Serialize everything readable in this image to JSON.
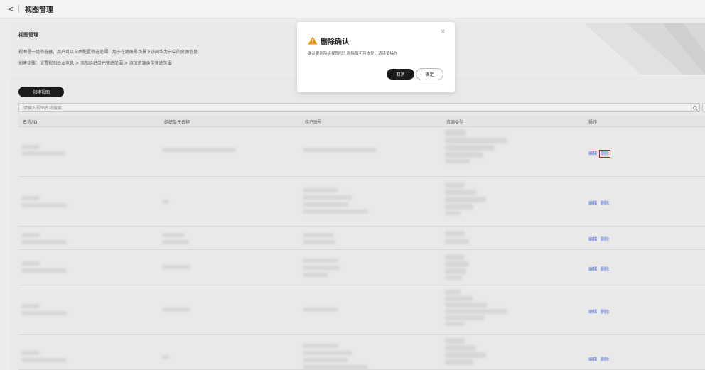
{
  "header": {
    "back_glyph": "<",
    "title": "视图管理"
  },
  "banner": {
    "title": "视图管理",
    "description": "视图是一组筛选器，用户可以自由配置筛选范围，用于在跨账号场景下访问华为云中的资源信息",
    "steps": "创建步骤：设置视图基本信息 > 添加组织单元筛选范围 > 添加资源类型筛选范围"
  },
  "toolbar": {
    "create_label": "创建视图"
  },
  "search": {
    "placeholder": "请输入视图名称搜索"
  },
  "table": {
    "columns": [
      "名称/ID",
      "组织单元名称",
      "租户账号",
      "资源类型",
      "操作"
    ],
    "rows": [
      {
        "edit": "编辑",
        "delete": "删除"
      },
      {
        "edit": "编辑",
        "delete": "删除"
      },
      {
        "edit": "编辑",
        "delete": "删除"
      },
      {
        "edit": "编辑",
        "delete": "删除"
      },
      {
        "edit": "编辑",
        "delete": "删除"
      },
      {
        "edit": "编辑",
        "delete": "删除"
      }
    ]
  },
  "dialog": {
    "title": "删除确认",
    "message": "确认要删除该视图吗？删除后不可恢复，请谨慎操作",
    "cancel_label": "取消",
    "confirm_label": "确定",
    "close_glyph": "×"
  },
  "icons": {
    "warning": "warning-icon",
    "search": "search-icon"
  },
  "colors": {
    "warning": "#f08c00",
    "link": "#4b6bd6",
    "highlight": "#dd1111"
  }
}
